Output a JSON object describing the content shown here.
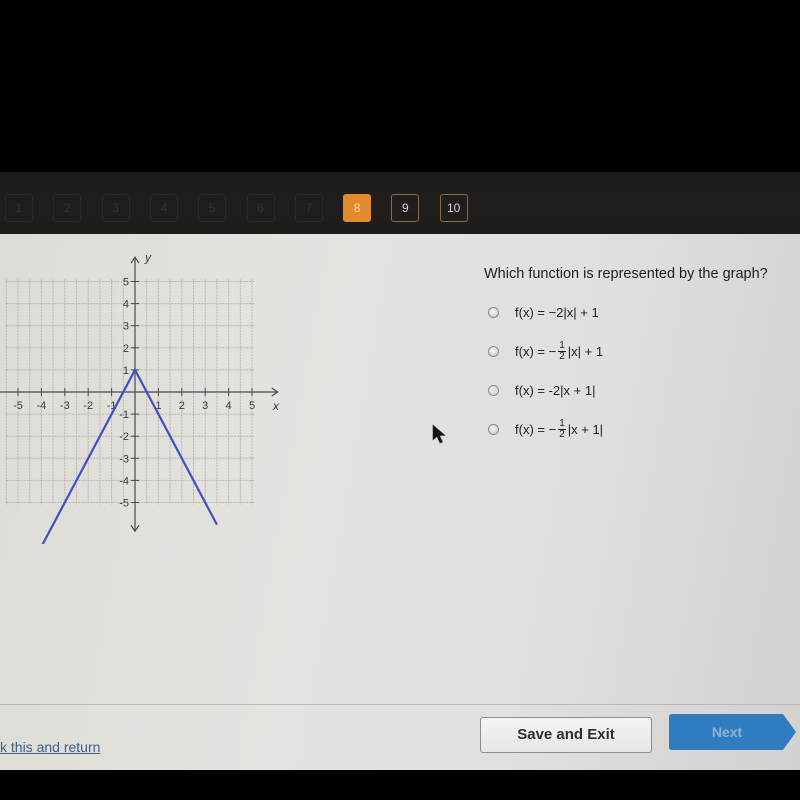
{
  "navigation": {
    "questions": [
      {
        "label": "1",
        "state": "dim"
      },
      {
        "label": "2",
        "state": "dim"
      },
      {
        "label": "3",
        "state": "dim"
      },
      {
        "label": "4",
        "state": "dim"
      },
      {
        "label": "5",
        "state": "dim"
      },
      {
        "label": "6",
        "state": "dim"
      },
      {
        "label": "7",
        "state": "dim"
      },
      {
        "label": "8",
        "state": "active"
      },
      {
        "label": "9",
        "state": "normal"
      },
      {
        "label": "10",
        "state": "normal"
      }
    ],
    "active_color": "#e38a2e"
  },
  "question": {
    "text": "Which function is represented by the graph?",
    "options": [
      {
        "prefix": "f(x) = −2|x| + 1",
        "fraction": null,
        "suffix": ""
      },
      {
        "prefix": "f(x) = −",
        "fraction": {
          "num": "1",
          "den": "2"
        },
        "suffix": "|x| + 1"
      },
      {
        "prefix": "f(x) = -2|x + 1|",
        "fraction": null,
        "suffix": ""
      },
      {
        "prefix": "f(x) = −",
        "fraction": {
          "num": "1",
          "den": "2"
        },
        "suffix": "|x + 1|"
      }
    ]
  },
  "graph": {
    "x_axis_label": "x",
    "y_axis_label": "y",
    "x_ticks": [
      "-5",
      "-4",
      "-3",
      "-2",
      "-1",
      "1",
      "2",
      "3",
      "4",
      "5"
    ],
    "y_ticks": [
      "5",
      "4",
      "3",
      "2",
      "1",
      "-1",
      "-2",
      "-3",
      "-4",
      "-5"
    ],
    "xlim": [
      -5,
      5
    ],
    "ylim": [
      -5,
      5
    ],
    "line_color": "#3f4fc4",
    "function_points": [
      [
        -4.1,
        -7.2
      ],
      [
        0,
        1
      ],
      [
        3.5,
        -6
      ]
    ]
  },
  "footer": {
    "mark_link": "k this and return",
    "save_exit_label": "Save and Exit",
    "next_label": "Next",
    "next_color": "#2f7cc1"
  }
}
